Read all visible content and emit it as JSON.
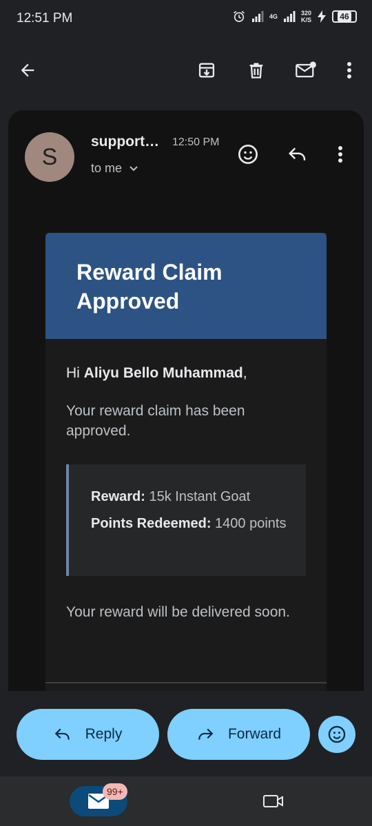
{
  "status": {
    "time": "12:51 PM",
    "net_type": "4G",
    "net_speed": "320",
    "net_unit": "K/S",
    "battery": "46"
  },
  "toolbar": {
    "back_icon": "arrow-back-icon",
    "archive_icon": "archive-icon",
    "delete_icon": "trash-icon",
    "unread_icon": "mark-unread-icon",
    "more_icon": "more-vert-icon"
  },
  "message": {
    "avatar_letter": "S",
    "sender": "support…",
    "time": "12:50 PM",
    "recipient": "to me"
  },
  "email": {
    "banner_title": "Reward Claim Approved",
    "greeting_prefix": "Hi ",
    "greeting_name": "Aliyu Bello Muhammad",
    "greeting_suffix": ",",
    "intro": "Your reward claim has been approved.",
    "reward_label": "Reward:",
    "reward_value": " 15k Instant Goat",
    "points_label": "Points Redeemed:",
    "points_value": " 1400 points",
    "closing": "Your reward will be delivered soon."
  },
  "actions": {
    "reply": "Reply",
    "forward": "Forward"
  },
  "bottom_nav": {
    "mail_badge": "99+"
  },
  "colors": {
    "banner": "#2d5385",
    "pill": "#7fcfff",
    "avatar": "#a1887f"
  }
}
